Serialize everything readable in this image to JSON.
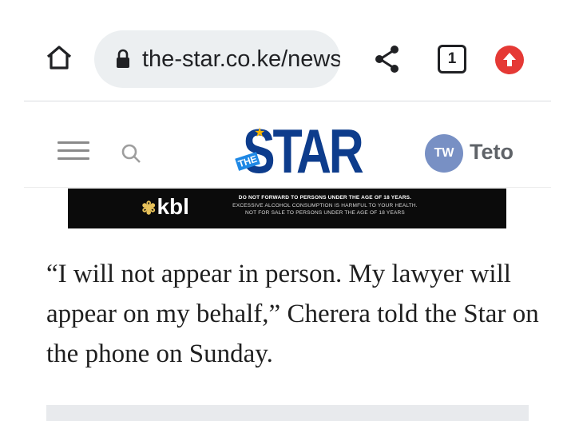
{
  "browser": {
    "url": "the-star.co.ke/news",
    "tab_count": "1",
    "icons": {
      "home": "home-icon",
      "lock": "lock-icon",
      "share": "share-icon",
      "tabs": "tabs-icon",
      "update": "update-arrow-icon"
    },
    "update_color": "#e53935"
  },
  "site_header": {
    "logo_text": "STAR",
    "logo_prefix": "THE",
    "logo_color": "#0d3c8c",
    "user_initials": "TW",
    "user_name": "Teto",
    "icons": {
      "menu": "hamburger-menu-icon",
      "search": "search-icon"
    }
  },
  "ad_banner": {
    "brand": "kbl",
    "lines": [
      "DO NOT FORWARD TO PERSONS UNDER THE AGE OF 18 YEARS.",
      "EXCESSIVE ALCOHOL CONSUMPTION IS HARMFUL TO YOUR HEALTH.",
      "NOT FOR SALE TO PERSONS UNDER THE AGE OF 18 YEARS"
    ]
  },
  "article": {
    "paragraph": "“I will not appear in person. My lawyer will appear on my behalf,” Cherera told the Star on the phone on Sunday."
  }
}
